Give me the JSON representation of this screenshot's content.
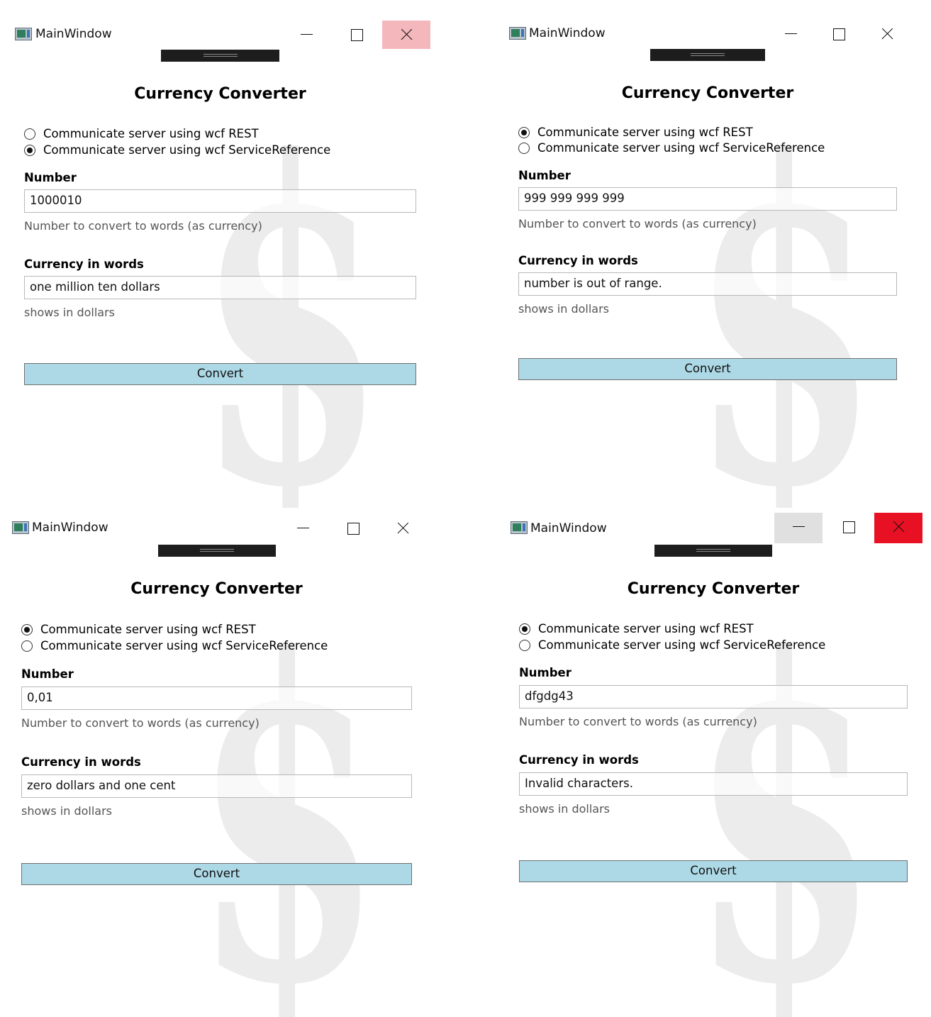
{
  "windows": [
    {
      "title": "MainWindow",
      "heading": "Currency Converter",
      "radio_rest_label": "Communicate server using wcf REST",
      "radio_ref_label": "Communicate server using wcf ServiceReference",
      "selected_option": "ServiceReference",
      "number_label": "Number",
      "number_value": "1000010",
      "number_hint": "Number to convert to words (as currency)",
      "words_label": "Currency in words",
      "words_value": "one million ten dollars",
      "words_hint": "shows in dollars",
      "convert_label": "Convert",
      "watermark": "$"
    },
    {
      "title": "MainWindow",
      "heading": "Currency Converter",
      "radio_rest_label": "Communicate server using wcf REST",
      "radio_ref_label": "Communicate server using wcf ServiceReference",
      "selected_option": "REST",
      "number_label": "Number",
      "number_value": "999 999 999 999",
      "number_hint": "Number to convert to words (as currency)",
      "words_label": "Currency in words",
      "words_value": "number is out of range.",
      "words_hint": "shows in dollars",
      "convert_label": "Convert",
      "watermark": "$"
    },
    {
      "title": "MainWindow",
      "heading": "Currency Converter",
      "radio_rest_label": "Communicate server using wcf REST",
      "radio_ref_label": "Communicate server using wcf ServiceReference",
      "selected_option": "REST",
      "number_label": "Number",
      "number_value": "0,01",
      "number_hint": "Number to convert to words (as currency)",
      "words_label": "Currency in words",
      "words_value": "zero dollars and one cent",
      "words_hint": "shows in dollars",
      "convert_label": "Convert",
      "watermark": "$"
    },
    {
      "title": "MainWindow",
      "heading": "Currency Converter",
      "radio_rest_label": "Communicate server using wcf REST",
      "radio_ref_label": "Communicate server using wcf ServiceReference",
      "selected_option": "REST",
      "number_label": "Number",
      "number_value": "dfgdg43",
      "number_hint": "Number to convert to words (as currency)",
      "words_label": "Currency in words",
      "words_value": "Invalid characters.",
      "words_hint": "shows in dollars",
      "convert_label": "Convert",
      "watermark": "$"
    }
  ],
  "colors": {
    "button_fill": "#add8e6",
    "close_hover": "#f4b7bb",
    "close_pressed": "#e81123",
    "minimize_hover": "#e0e0e0"
  }
}
